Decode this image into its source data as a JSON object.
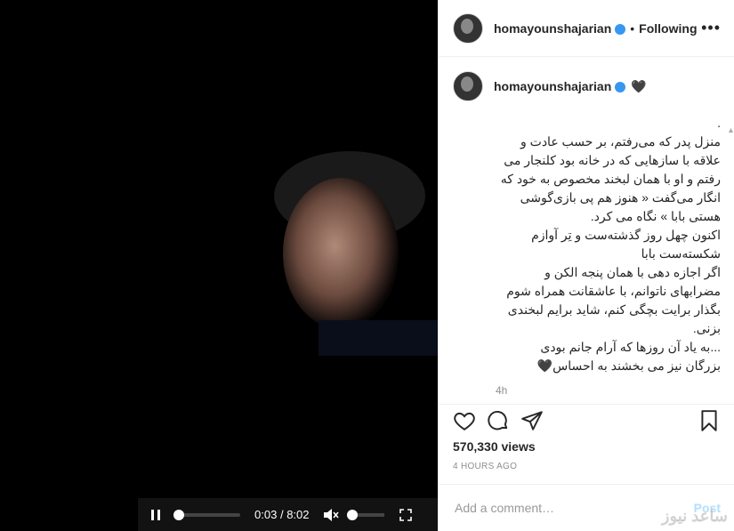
{
  "header": {
    "username": "homayounshajarian",
    "separator": "•",
    "following_label": "Following",
    "more_icon": "more-icon"
  },
  "caption": {
    "username": "homayounshajarian",
    "heart_emoji": "🖤",
    "text": ".\nمنزل پدر که می‌رفتم، بر حسب عادت و علاقه با سازهایی که در خانه بود کلنجار می رفتم و او با همان لبخند مخصوص به خود که انگار می‌گفت « هنوز هم پی بازی‌گوشی هستی بابا » نگاه می کرد.\nاکنون چهل روز گذشته‌ست و تِر آوازم شکسته‌ست بابا\nاگر اجازه دهی با همان پنجه الکن و مضرابهای ناتوانم، با عاشقانت همراه شوم\nبگذار برایت بچگی کنم، شاید برایم لبخندی بزنی.\n...به یاد آن روزها که آرام جانم بودی\nبزرگان نیز می بخشند به احساس🖤",
    "time_ago": "4h"
  },
  "video": {
    "current_time": "0:03",
    "duration": "8:02",
    "time_separator": "/",
    "progress": 0.006,
    "volume": 0.0
  },
  "stats": {
    "views": "570,330 views",
    "posted": "4 HOURS AGO"
  },
  "comment": {
    "placeholder": "Add a comment…",
    "post_label": "Post"
  },
  "watermark": "ساعد نیوز",
  "colors": {
    "verified": "#3897f0",
    "post_button": "#b2dffc"
  }
}
